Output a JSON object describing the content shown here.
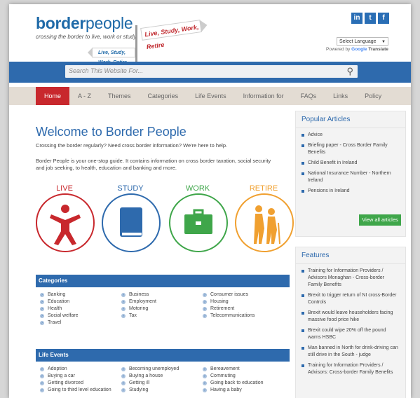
{
  "header": {
    "logo_bold": "border",
    "logo_light": "people",
    "tagline": "crossing the border to live, work or study",
    "sign_right": "Live, Study, Work, Retire",
    "sign_left": "Live, Study, Work, Retire",
    "language_select": "Select Language",
    "powered_by": "Powered by",
    "google": "Google",
    "translate": "Translate",
    "social": [
      "in",
      "t",
      "f"
    ]
  },
  "search": {
    "placeholder": "Search This Website For..."
  },
  "nav": [
    "Home",
    "A - Z",
    "Themes",
    "Categories",
    "Life Events",
    "Information for",
    "FAQs",
    "Links",
    "Policy"
  ],
  "main": {
    "title": "Welcome to Border People",
    "intro1": "Crossing the border regularly? Need cross border information? We're here to help.",
    "intro2": "Border People is your one-stop guide. It contains information on cross border taxation, social security and job seeking, to health, education and banking and more.",
    "categories_icons": [
      {
        "label": "LIVE",
        "color": "#c8282d",
        "icon": "person-icon"
      },
      {
        "label": "STUDY",
        "color": "#2e6aad",
        "icon": "book-icon"
      },
      {
        "label": "WORK",
        "color": "#3fa64a",
        "icon": "briefcase-icon"
      },
      {
        "label": "RETIRE",
        "color": "#f0a030",
        "icon": "elderly-couple-icon"
      }
    ]
  },
  "categories_box": {
    "title": "Categories",
    "items": [
      "Banking",
      "Business",
      "Consumer issues",
      "Education",
      "Employment",
      "Housing",
      "Health",
      "Motoring",
      "Retirement",
      "Social welfare",
      "Tax",
      "Telecommunications",
      "Travel"
    ]
  },
  "life_events_box": {
    "title": "Life Events",
    "items": [
      "Adoption",
      "Becoming unemployed",
      "Bereavement",
      "Buying a car",
      "Buying a house",
      "Commuting",
      "Getting divorced",
      "Getting ill",
      "Going back to education",
      "Going to third level education",
      "Studying",
      "Having a baby"
    ]
  },
  "popular": {
    "title": "Popular Articles",
    "items": [
      "Advice",
      "Briefing paper - Cross Border Family Benefits",
      "Child Benefit in Ireland",
      "National Insurance Number - Northern Ireland",
      "Pensions in Ireland"
    ],
    "view_all": "View all articles"
  },
  "features": {
    "title": "Features",
    "items": [
      "Training for Information Providers / Advisors Monaghan - Cross-border Family Benefits",
      "Brexit to trigger return of NI cross-Border Controls",
      "Brexit would leave householders facing massive food price hike",
      "Brexit could wipe 20% off the pound warns HSBC",
      "Man banned in North for drink-driving can still drive in the South - judge",
      "Training for Information Providers / Advisors: Cross-border Family Benefits"
    ]
  }
}
